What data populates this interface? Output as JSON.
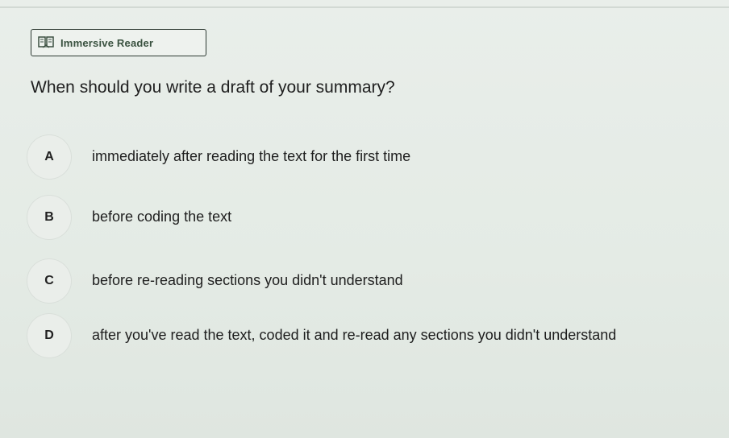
{
  "toolbar": {
    "immersive_reader_label": "Immersive Reader"
  },
  "question": {
    "text": "When should you write a draft of your summary?"
  },
  "options": [
    {
      "letter": "A",
      "text": "immediately after reading the text for the first time"
    },
    {
      "letter": "B",
      "text": "before coding the text"
    },
    {
      "letter": "C",
      "text": "before re-reading sections you didn't understand"
    },
    {
      "letter": "D",
      "text": "after you've read the text, coded it and re-read any sections you didn't understand"
    }
  ],
  "icons": {
    "reader": "immersive-reader-icon"
  }
}
